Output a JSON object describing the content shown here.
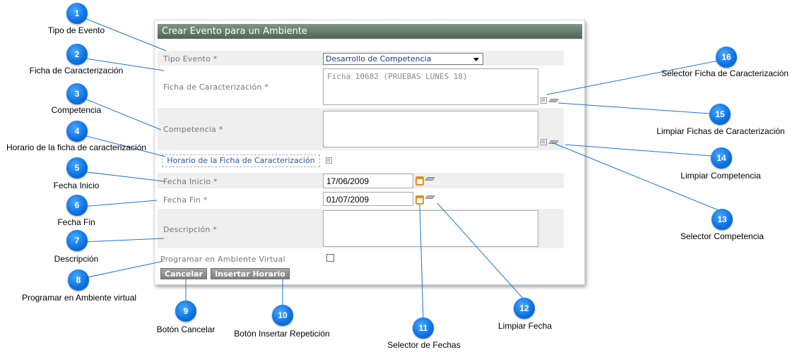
{
  "dialog": {
    "title": "Crear Evento para un Ambiente",
    "tipo_evento_label": "Tipo Evento *",
    "tipo_evento_value": "Desarrollo de Competencia",
    "ficha_label": "Ficha de Caracterización *",
    "ficha_value": "Ficha 10682 (PRUEBAS LUNES 18)",
    "competencia_label": "Competencia *",
    "competencia_value": "",
    "horario_link": "Horario de la Ficha de Caracterización",
    "fecha_inicio_label": "Fecha Inicio *",
    "fecha_inicio_value": "17/06/2009",
    "fecha_fin_label": "Fecha Fin *",
    "fecha_fin_value": "01/07/2009",
    "descripcion_label": "Descripción *",
    "descripcion_value": "",
    "virtual_label": "Programar en Ambiente Virtual",
    "virtual_checked": false,
    "cancel_button": "Cancelar",
    "insert_button": "Insertar Horario"
  },
  "callouts": [
    {
      "num": "1",
      "text": "Tipo de Evento"
    },
    {
      "num": "2",
      "text": "Ficha de Caracterización"
    },
    {
      "num": "3",
      "text": "Competencia"
    },
    {
      "num": "4",
      "text": "Horario de la ficha de caracterización"
    },
    {
      "num": "5",
      "text": "Fecha Inicio"
    },
    {
      "num": "6",
      "text": "Fecha Fin"
    },
    {
      "num": "7",
      "text": "Descripción"
    },
    {
      "num": "8",
      "text": "Programar en Ambiente virtual"
    },
    {
      "num": "9",
      "text": "Botón Cancelar"
    },
    {
      "num": "10",
      "text": "Botón Insertar Repetición"
    },
    {
      "num": "11",
      "text": "Selector de Fechas"
    },
    {
      "num": "12",
      "text": "Limpiar Fecha"
    },
    {
      "num": "13",
      "text": "Selector Competencia"
    },
    {
      "num": "14",
      "text": "Limpiar Competencia"
    },
    {
      "num": "15",
      "text": "Limpiar Fichas de Caracterización"
    },
    {
      "num": "16",
      "text": "Selector Ficha de Caracterización"
    }
  ],
  "colors": {
    "badge": "#0a6fe0",
    "title_bar": "#5f7766",
    "line": "#1e73d8"
  }
}
